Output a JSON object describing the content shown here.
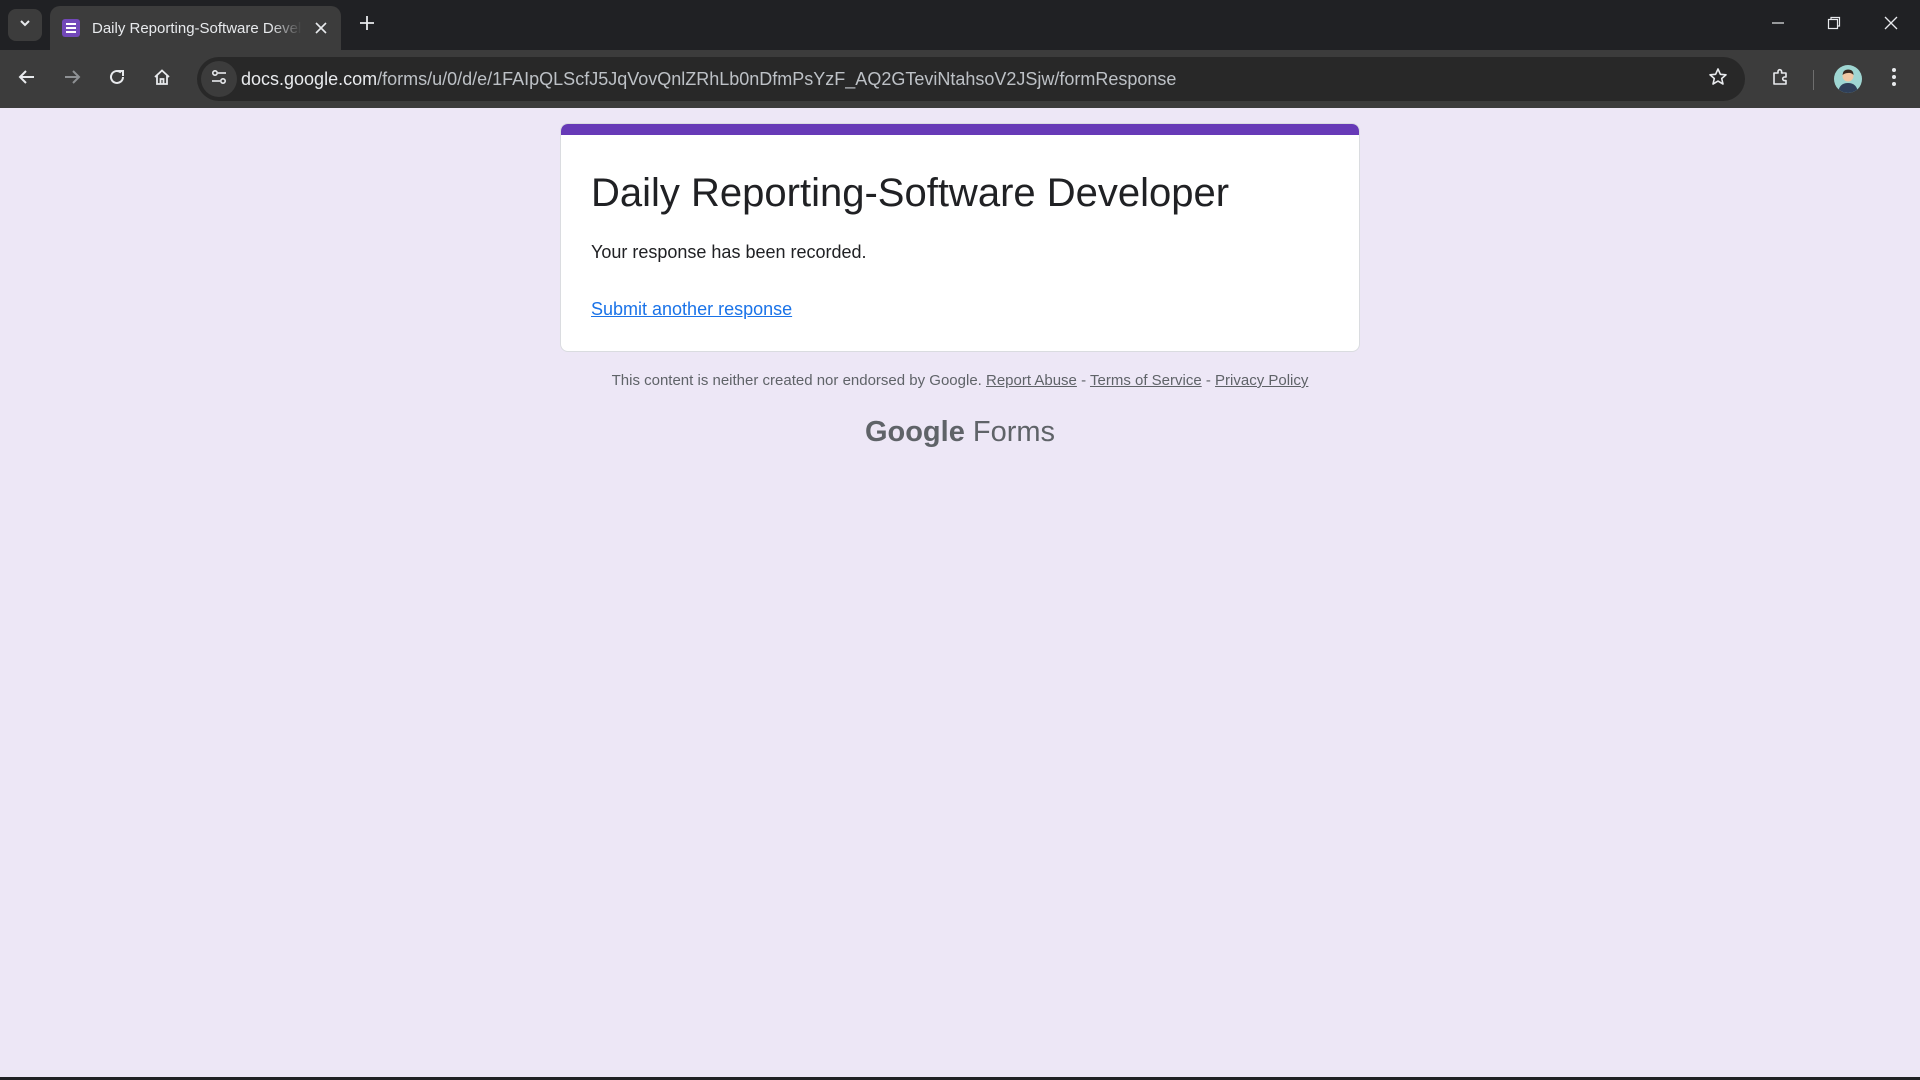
{
  "browser": {
    "tab_title": "Daily Reporting-Software Developer",
    "url_host": "docs.google.com",
    "url_path": "/forms/u/0/d/e/1FAIpQLScfJ5JqVovQnlZRhLb0nDfmPsYzF_AQ2GTeviNtahsoV2JSjw/formResponse"
  },
  "form": {
    "title": "Daily Reporting-Software Developer",
    "confirmation": "Your response has been recorded.",
    "another_link": "Submit another response"
  },
  "footer": {
    "disclaimer": "This content is neither created nor endorsed by Google.",
    "report_abuse": "Report Abuse",
    "terms": "Terms of Service",
    "privacy": "Privacy Policy",
    "separator": "-",
    "brand_google": "Google",
    "brand_forms": "Forms"
  },
  "colors": {
    "accent": "#673ab7",
    "page_bg": "#ede7f6",
    "link": "#1a73e8"
  }
}
